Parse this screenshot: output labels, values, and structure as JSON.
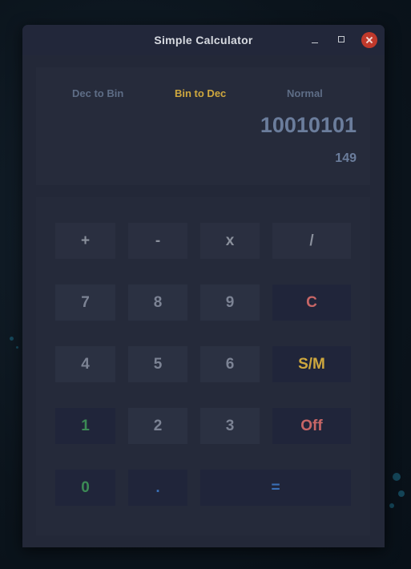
{
  "window": {
    "title": "Simple Calculator"
  },
  "modes": [
    {
      "label": "Dec to Bin",
      "active": false
    },
    {
      "label": "Bin to Dec",
      "active": true
    },
    {
      "label": "Normal",
      "active": false
    }
  ],
  "display": {
    "main": "10010101",
    "secondary": "149"
  },
  "keys": {
    "plus": "+",
    "minus": "-",
    "multiply": "x",
    "divide": "/",
    "seven": "7",
    "eight": "8",
    "nine": "9",
    "clear": "C",
    "four": "4",
    "five": "5",
    "six": "6",
    "sm": "S/M",
    "one": "1",
    "two": "2",
    "three": "3",
    "off": "Off",
    "zero": "0",
    "dot": ".",
    "equals": "="
  },
  "colors": {
    "accent_active": "#cfa83e",
    "red": "#c76666",
    "green": "#3c8a55",
    "blue": "#3a6fb5"
  }
}
